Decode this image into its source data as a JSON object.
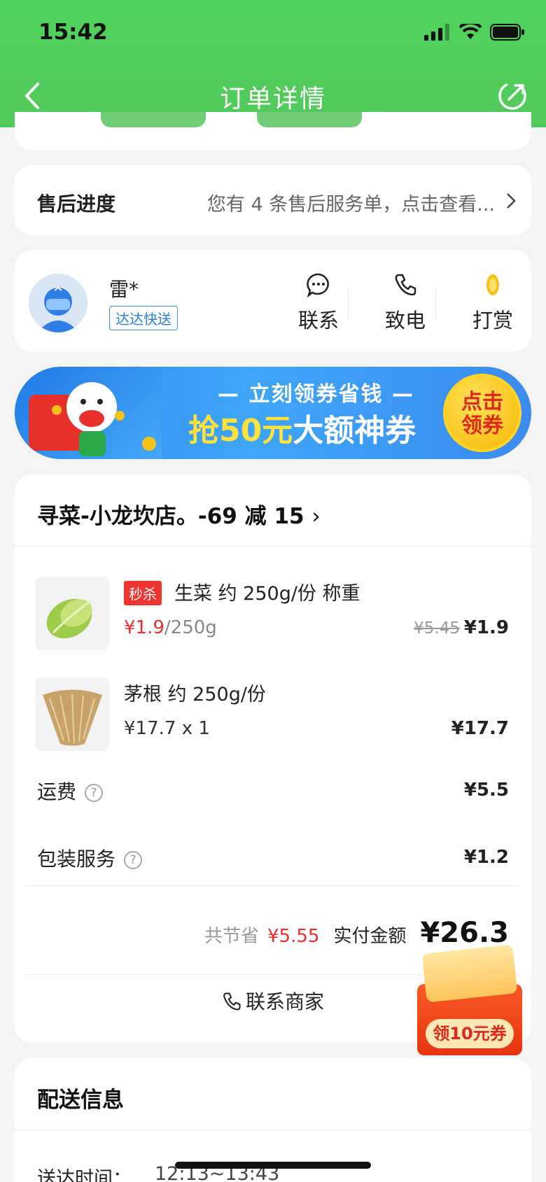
{
  "status_bar": {
    "time": "15:42"
  },
  "nav": {
    "title": "订单详情"
  },
  "after_sales": {
    "label": "售后进度",
    "text": "您有 4 条售后服务单，点击查看..."
  },
  "rider": {
    "name": "雷*",
    "badge": "达达快送",
    "actions": [
      {
        "label": "联系",
        "icon": "chat-icon"
      },
      {
        "label": "致电",
        "icon": "phone-icon"
      },
      {
        "label": "打赏",
        "icon": "coin-icon"
      }
    ]
  },
  "banner": {
    "subtitle": "— 立刻领券省钱 —",
    "main_highlight": "抢50元",
    "main_rest": "大额神券",
    "button_line1": "点击",
    "button_line2": "领券"
  },
  "order": {
    "shop_name": "寻菜-小龙坎店。-69 减 15",
    "items": [
      {
        "tag": "秒杀",
        "name": "生菜  约 250g/份 称重",
        "price": "¥1.9",
        "unit": "/250g",
        "original": "¥5.45",
        "total": "¥1.9"
      },
      {
        "name": "茅根  约 250g/份",
        "price": "¥17.7   x  1",
        "total": "¥17.7"
      }
    ],
    "fees": [
      {
        "label": "运费",
        "value": "¥5.5"
      },
      {
        "label": "包装服务",
        "value": "¥1.2"
      }
    ],
    "saved_label": "共节省",
    "saved_value": "¥5.55",
    "paid_label": "实付金额",
    "paid_value": "¥26.3",
    "contact_label": "联系商家"
  },
  "coupon_float": {
    "label": "领10元券"
  },
  "delivery": {
    "title": "配送信息",
    "time_label": "送达时间：",
    "time_value": "12:13~13:43"
  }
}
